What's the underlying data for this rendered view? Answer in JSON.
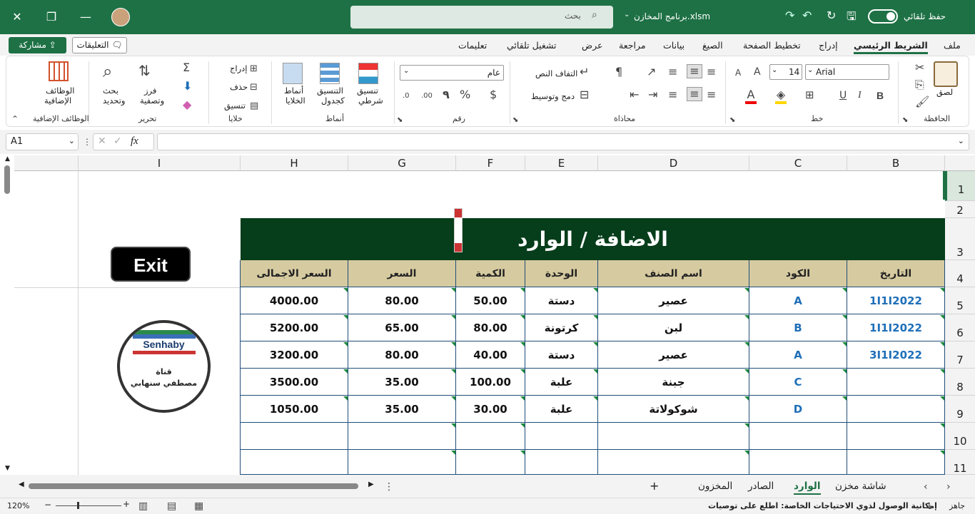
{
  "titlebar": {
    "autosave_label": "حفظ تلقائي",
    "filename": "برنامج المخازن.xlsm",
    "search_placeholder": "بحث"
  },
  "menubar": {
    "file": "ملف",
    "home": "الشريط الرئيسي",
    "insert": "إدراج",
    "page_layout": "تخطيط الصفحة",
    "formulas": "الصيغ",
    "data": "بيانات",
    "review": "مراجعة",
    "view": "عرض",
    "automate": "تشغيل تلقائي",
    "help": "تعليمات",
    "comments": "التعليقات",
    "share": "مشاركة"
  },
  "ribbon": {
    "clipboard": {
      "paste": "لصق",
      "group": "الحافظة"
    },
    "font": {
      "name": "Arial",
      "size": "14",
      "bold": "B",
      "italic": "I",
      "underline": "U",
      "grow": "A",
      "shrink": "A",
      "group": "خط"
    },
    "alignment": {
      "wrap": "التفاف النص",
      "merge": "دمج وتوسيط",
      "group": "محاذاة"
    },
    "number": {
      "format": "عام",
      "currency": "$",
      "percent": "%",
      "comma": "٩",
      "dec_inc": ".00",
      "dec_dec": ".0",
      "group": "رقم"
    },
    "styles": {
      "conditional_1": "تنسيق",
      "conditional_2": "شرطي",
      "table_1": "التنسيق",
      "table_2": "كجدول",
      "cell_1": "أنماط",
      "cell_2": "الخلايا",
      "group": "أنماط"
    },
    "cells": {
      "insert": "إدراج",
      "delete": "حذف",
      "format": "تنسيق",
      "group": "خلايا"
    },
    "editing": {
      "sum": "Σ",
      "sort_1": "فرز",
      "sort_2": "وتصفية",
      "find_1": "بحث",
      "find_2": "وتحديد",
      "group": "تحرير"
    },
    "addins": {
      "label_1": "الوظائف",
      "label_2": "الإضافية",
      "group": "الوظائف الإضافية"
    }
  },
  "formula_bar": {
    "namebox": "A1",
    "fx": "fx",
    "value": ""
  },
  "columns": [
    "B",
    "C",
    "D",
    "E",
    "F",
    "G",
    "H",
    "I"
  ],
  "rows": [
    "1",
    "2",
    "3",
    "4",
    "5",
    "6",
    "7",
    "8",
    "9",
    "10",
    "11"
  ],
  "sheet": {
    "banner": "الاضافة / الوارد",
    "exit_button": "Exit",
    "logo_brand": "Senhaby",
    "logo_line1": "قناة",
    "logo_line2": "مصطفي سنهابي",
    "headers": [
      "التاريخ",
      "الكود",
      "اسم الصنف",
      "الوحدة",
      "الكمية",
      "السعر",
      "السعر الاجمالى"
    ],
    "records": [
      [
        "1I1I2022",
        "A",
        "عصير",
        "دستة",
        "50.00",
        "80.00",
        "4000.00"
      ],
      [
        "1I1I2022",
        "B",
        "لبن",
        "كرتونة",
        "80.00",
        "65.00",
        "5200.00"
      ],
      [
        "3I1I2022",
        "A",
        "عصير",
        "دستة",
        "40.00",
        "80.00",
        "3200.00"
      ],
      [
        "",
        "C",
        "جبنة",
        "علبة",
        "100.00",
        "35.00",
        "3500.00"
      ],
      [
        "",
        "D",
        "شوكولاتة",
        "علبة",
        "30.00",
        "35.00",
        "1050.00"
      ],
      [
        "",
        "",
        "",
        "",
        "",
        "",
        ""
      ],
      [
        "",
        "",
        "",
        "",
        "",
        "",
        ""
      ]
    ]
  },
  "tabs": {
    "home_screen": "شاشة مخزن",
    "incoming": "الوارد",
    "outgoing": "الصادر",
    "stock": "المخزون",
    "add": "+"
  },
  "status": {
    "ready": "جاهز",
    "accessibility": "إمكانية الوصول لذوي الاحتياجات الخاصة: اطلع على توصيات",
    "zoom": "120%"
  }
}
